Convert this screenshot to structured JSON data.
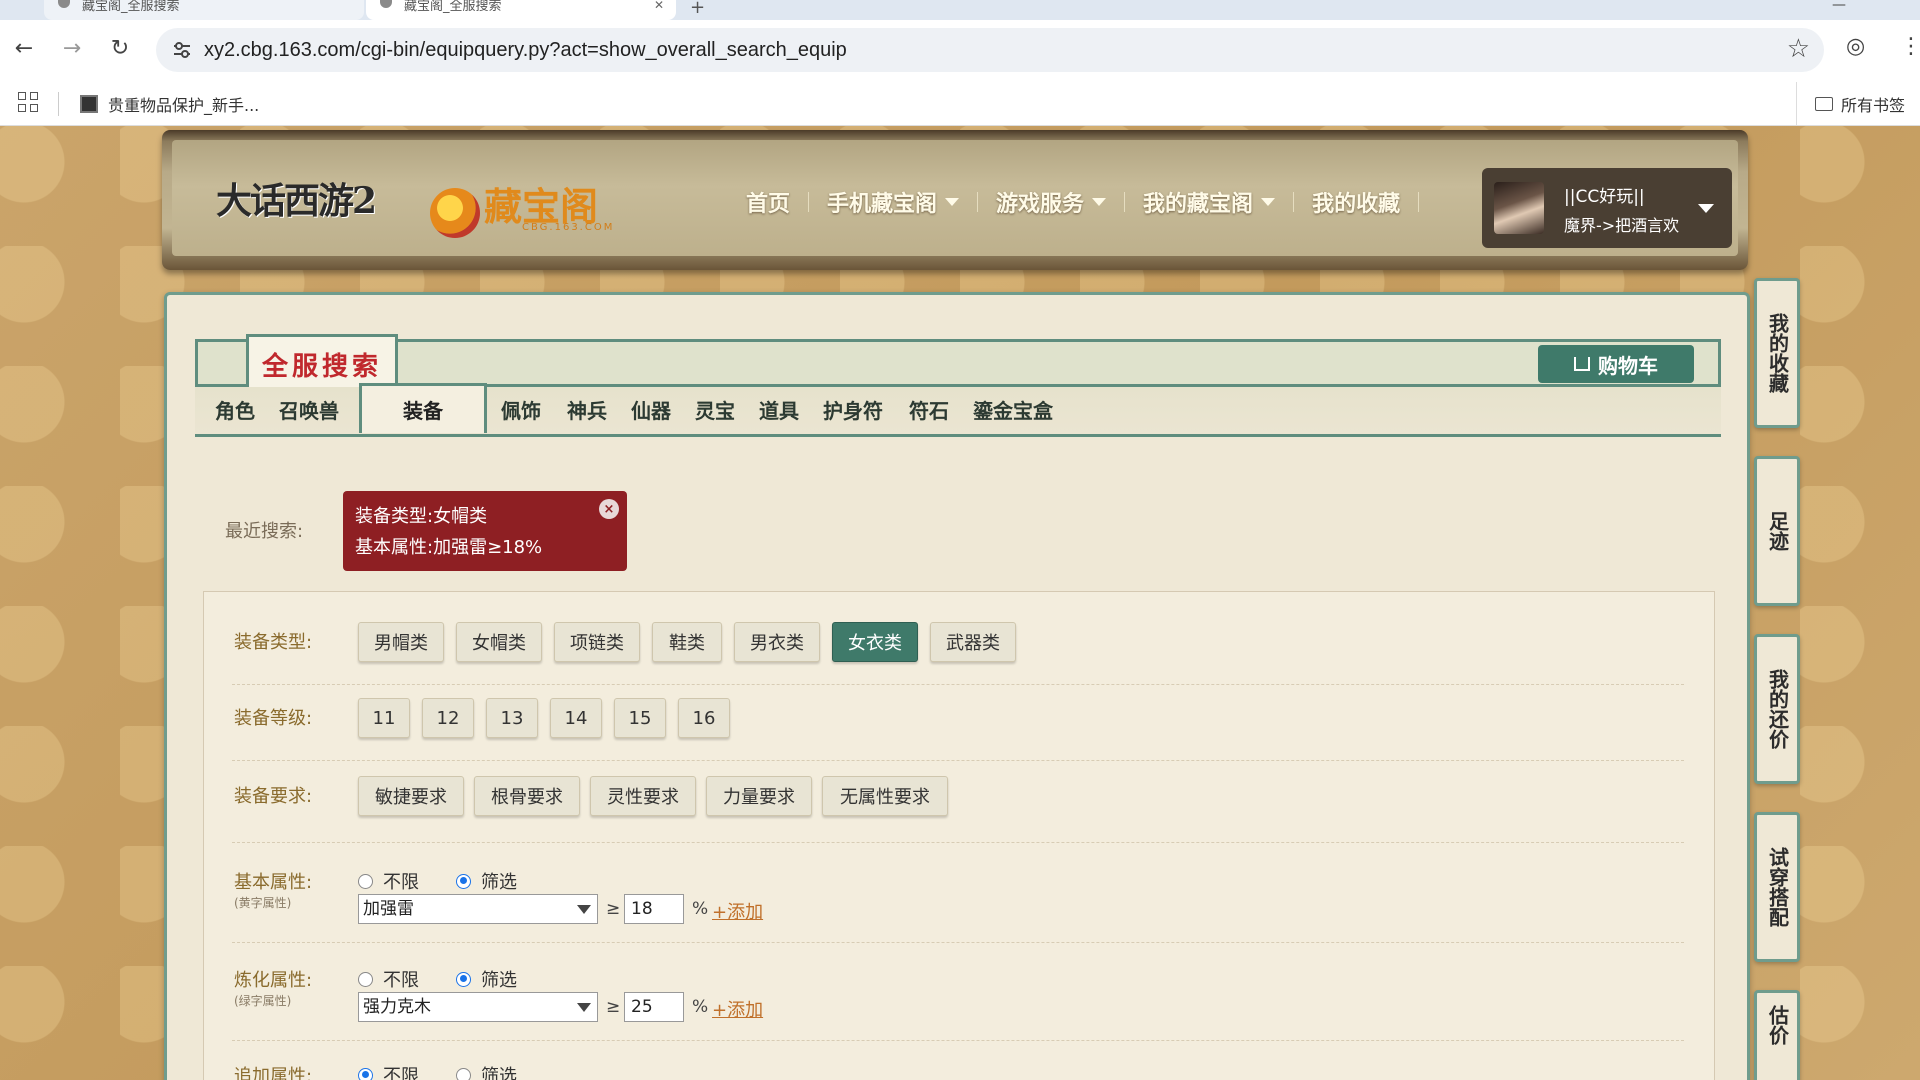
{
  "browser": {
    "tabs": [
      {
        "title": "藏宝阁_全服搜索"
      },
      {
        "title": "藏宝阁_全服搜索"
      }
    ],
    "new_tab_symbol": "+",
    "url": "xy2.cbg.163.com/cgi-bin/equipquery.py?act=show_overall_search_equip",
    "bookmark_item": "贵重物品保护_新手...",
    "all_bookmarks": "所有书签"
  },
  "header": {
    "game_logo": "大话西游2",
    "cbg_logo": "藏宝阁",
    "cbg_sub": "CBG.163.COM",
    "nav": [
      {
        "label": "首页",
        "has_caret": false
      },
      {
        "label": "手机藏宝阁",
        "has_caret": true
      },
      {
        "label": "游戏服务",
        "has_caret": true
      },
      {
        "label": "我的藏宝阁",
        "has_caret": true
      },
      {
        "label": "我的收藏",
        "has_caret": false
      }
    ],
    "user": {
      "name": "||CC好玩||",
      "server": "魔界->把酒言欢"
    }
  },
  "search": {
    "title": "全服搜索",
    "cart": "购物车",
    "categories": [
      "角色",
      "召唤兽",
      "装备",
      "佩饰",
      "神兵",
      "仙器",
      "灵宝",
      "道具",
      "护身符",
      "符石",
      "鎏金宝盒"
    ],
    "active_category": "装备",
    "recent_label": "最近搜索:",
    "recent": {
      "line1": "装备类型:女帽类",
      "line2": "基本属性:加强雷≥18%",
      "close": "×"
    }
  },
  "filters": {
    "type": {
      "label": "装备类型:",
      "options": [
        "男帽类",
        "女帽类",
        "项链类",
        "鞋类",
        "男衣类",
        "女衣类",
        "武器类"
      ],
      "active": "女衣类"
    },
    "level": {
      "label": "装备等级:",
      "options": [
        "11",
        "12",
        "13",
        "14",
        "15",
        "16"
      ]
    },
    "requirement": {
      "label": "装备要求:",
      "options": [
        "敏捷要求",
        "根骨要求",
        "灵性要求",
        "力量要求",
        "无属性要求"
      ]
    },
    "basic": {
      "label": "基本属性:",
      "sub": "(黄字属性)",
      "radio_none": "不限",
      "radio_filter": "筛选",
      "selected": "筛选",
      "select_value": "加强雷",
      "ge": "≥",
      "value": "18",
      "pct": "%",
      "add": "+添加"
    },
    "refine": {
      "label": "炼化属性:",
      "sub": "(绿字属性)",
      "radio_none": "不限",
      "radio_filter": "筛选",
      "selected": "筛选",
      "select_value": "强力克木",
      "ge": "≥",
      "value": "25",
      "pct": "%",
      "add": "+添加"
    },
    "extra": {
      "label": "追加属性:",
      "radio_none": "不限",
      "radio_filter": "筛选",
      "selected": "不限"
    }
  },
  "rail": {
    "favorites": "我的收藏",
    "footprints": "足迹",
    "bargain": "我的还价",
    "tryon": "试穿搭配",
    "estimate": "估价"
  }
}
